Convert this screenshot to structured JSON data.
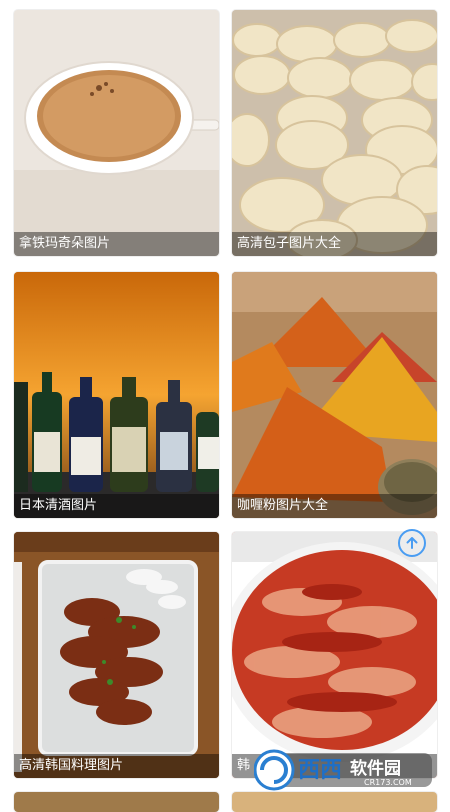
{
  "cards": [
    {
      "caption": "拿铁玛奇朵图片",
      "image_alt": "latte cup"
    },
    {
      "caption": "高清包子图片大全",
      "image_alt": "steamed buns"
    },
    {
      "caption": "日本清酒图片",
      "image_alt": "sake bottles"
    },
    {
      "caption": "咖喱粉图片大全",
      "image_alt": "curry powder"
    },
    {
      "caption": "高清韩国料理图片",
      "image_alt": "korean dish"
    },
    {
      "caption": "韩",
      "image_alt": "kimchi"
    }
  ],
  "watermark": {
    "brand": "西西",
    "site": "软件园",
    "url": "CR173.COM"
  },
  "colors": {
    "accent": "#4a9df2",
    "caption_bg": "rgba(0,0,0,0.42)"
  },
  "icons": {
    "back_to_top": "arrow-up-circle-icon"
  }
}
